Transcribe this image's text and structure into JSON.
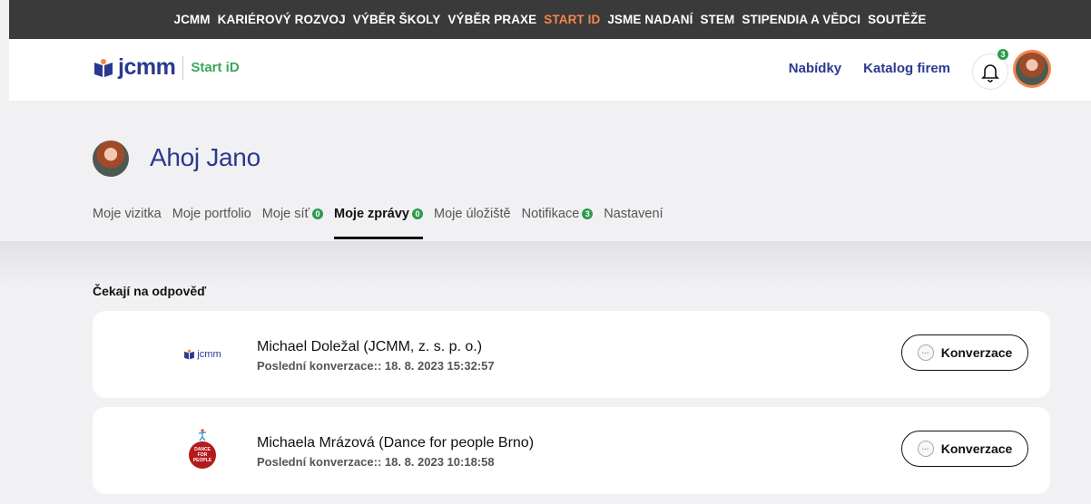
{
  "top_nav": {
    "items": [
      {
        "label": "JCMM"
      },
      {
        "label": "KARIÉROVÝ ROZVOJ"
      },
      {
        "label": "VÝBĚR ŠKOLY"
      },
      {
        "label": "VÝBĚR PRAXE"
      },
      {
        "label": "START ID",
        "active": true
      },
      {
        "label": "JSME NADANÍ"
      },
      {
        "label": "STEM"
      },
      {
        "label": "STIPENDIA A VĚDCI"
      },
      {
        "label": "SOUTĚŽE"
      }
    ],
    "active_color": "#f2874b"
  },
  "header": {
    "logo_text": "jcmm",
    "logo_sub": "Start iD",
    "links": [
      "Nabídky",
      "Katalog firem"
    ],
    "notifications_count": "3"
  },
  "profile": {
    "greeting": "Ahoj Jano",
    "tabs": [
      {
        "label": "Moje vizitka"
      },
      {
        "label": "Moje portfolio"
      },
      {
        "label": "Moje síť",
        "badge": "0"
      },
      {
        "label": "Moje zprávy",
        "badge": "0",
        "active": true
      },
      {
        "label": "Moje úložiště"
      },
      {
        "label": "Notifikace",
        "badge": "3"
      },
      {
        "label": "Nastavení"
      }
    ]
  },
  "messages": {
    "section_title": "Čekají na odpověď",
    "items": [
      {
        "name": "Michael Doležal (JCMM, z. s. p. o.)",
        "last": "Poslední konverzace:: 18. 8. 2023 15:32:57",
        "logo_text": "jcmm",
        "button_label": "Konverzace"
      },
      {
        "name": "Michaela Mrázová (Dance for people Brno)",
        "last": "Poslední konverzace:: 18. 8. 2023 10:18:58",
        "logo_text": "DANCE FOR PEOPLE",
        "button_label": "Konverzace"
      }
    ]
  },
  "colors": {
    "brand_blue": "#2b3990",
    "green_badge": "#2e9b4e",
    "accent_orange": "#f2874b",
    "topbar": "#3a3a3a"
  }
}
